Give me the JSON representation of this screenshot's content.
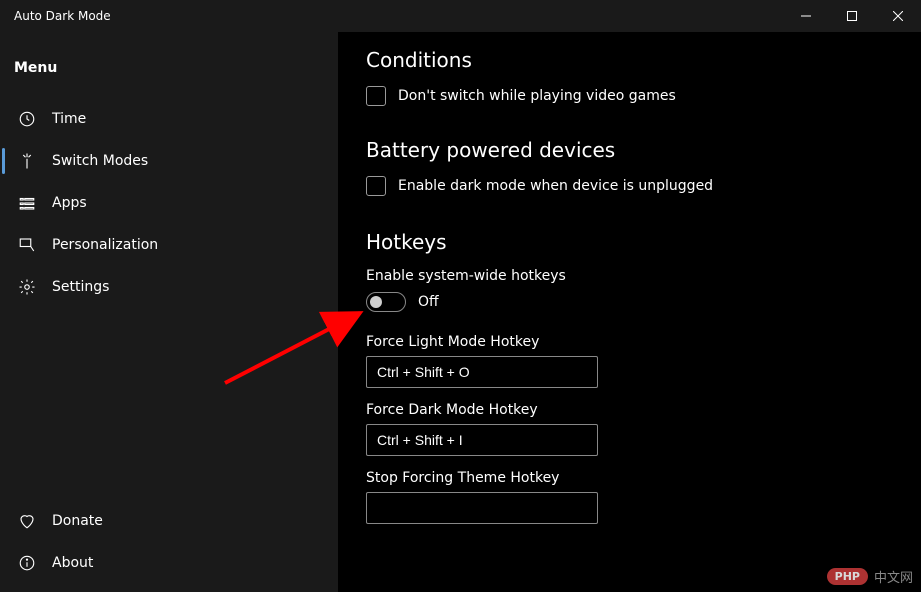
{
  "window": {
    "title": "Auto Dark Mode"
  },
  "sidebar": {
    "menu_label": "Menu",
    "items": [
      {
        "icon": "clock-icon",
        "label": "Time"
      },
      {
        "icon": "switch-icon",
        "label": "Switch Modes"
      },
      {
        "icon": "apps-icon",
        "label": "Apps"
      },
      {
        "icon": "brush-icon",
        "label": "Personalization"
      },
      {
        "icon": "gear-icon",
        "label": "Settings"
      }
    ],
    "bottom": [
      {
        "icon": "heart-icon",
        "label": "Donate"
      },
      {
        "icon": "info-icon",
        "label": "About"
      }
    ]
  },
  "content": {
    "conditions": {
      "title": "Conditions",
      "checkbox_label": "Don't switch while playing video games"
    },
    "battery": {
      "title": "Battery powered devices",
      "checkbox_label": "Enable dark mode when device is unplugged"
    },
    "hotkeys": {
      "title": "Hotkeys",
      "enable_label": "Enable system-wide hotkeys",
      "toggle_state": "Off",
      "light": {
        "caption": "Force Light Mode Hotkey",
        "value": "Ctrl + Shift + O"
      },
      "dark": {
        "caption": "Force Dark Mode Hotkey",
        "value": "Ctrl + Shift + I"
      },
      "stop": {
        "caption": "Stop Forcing Theme Hotkey",
        "value": ""
      }
    }
  },
  "watermark": {
    "badge": "PHP",
    "text": "中文网"
  }
}
